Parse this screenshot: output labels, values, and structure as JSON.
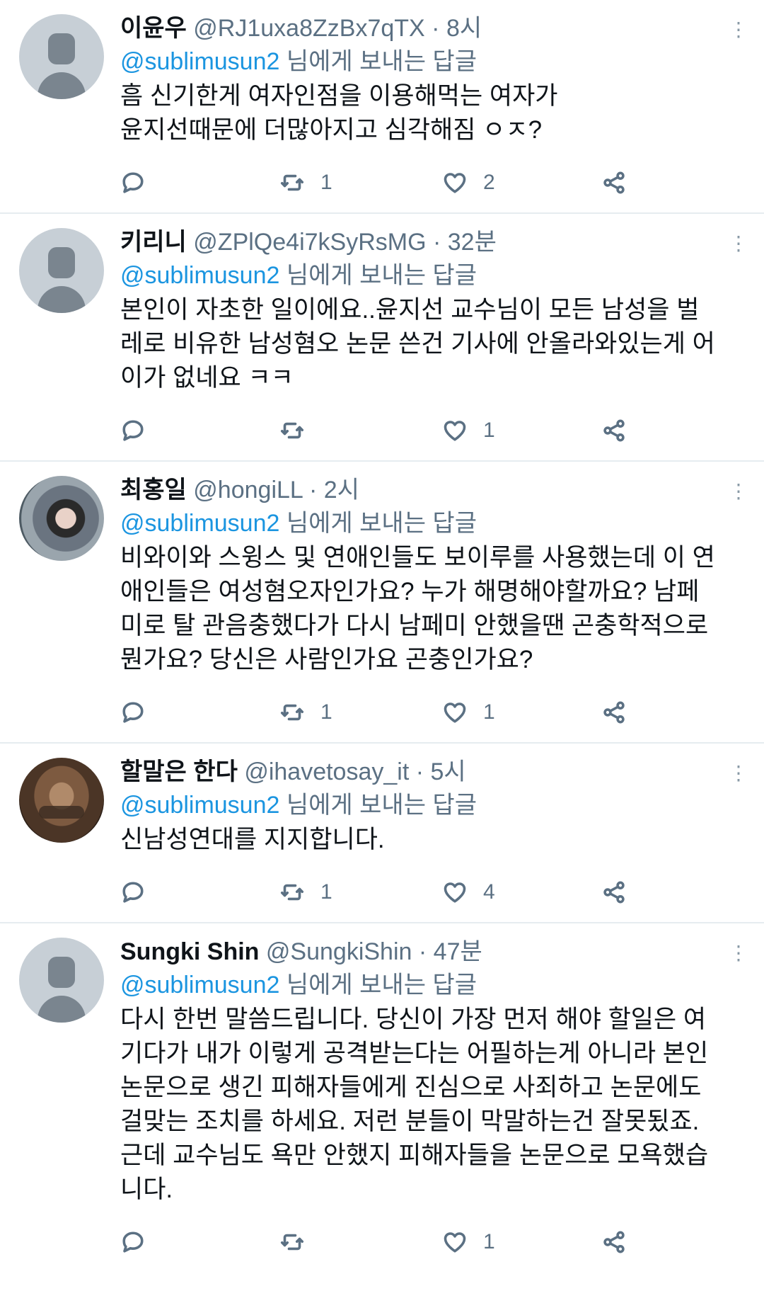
{
  "colors": {
    "text": "#0f1419",
    "muted": "#5b7083",
    "mention": "#1b95e0",
    "divider": "#e6ecf0"
  },
  "tweets": [
    {
      "name": "이윤우",
      "handle": "@RJ1uxa8ZzBx7qTX",
      "time": "8시",
      "reply_mention": "@sublimusun2",
      "reply_suffix": " 님에게 보내는 답글",
      "text": "흠 신기한게 여자인점을 이용해먹는 여자가\n윤지선때문에 더많아지고 심각해짐 ㅇㅈ?",
      "retweets": "1",
      "likes": "2",
      "avatar": "default"
    },
    {
      "name": "키리니",
      "handle": "@ZPlQe4i7kSyRsMG",
      "time": "32분",
      "reply_mention": "@sublimusun2",
      "reply_suffix": " 님에게 보내는 답글",
      "text": "본인이 자초한 일이에요..윤지선 교수님이 모든 남성을 벌\n레로 비유한 남성혐오 논문 쓴건 기사에 안올라와있는게 어\n이가 없네요 ㅋㅋ",
      "retweets": "",
      "likes": "1",
      "avatar": "default"
    },
    {
      "name": "최홍일",
      "handle": "@hongiLL",
      "time": "2시",
      "reply_mention": "@sublimusun2",
      "reply_suffix": " 님에게 보내는 답글",
      "text": "비와이와 스윙스 및 연애인들도 보이루를 사용했는데 이 연\n애인들은 여성혐오자인가요? 누가 해명해야할까요? 남페\n미로 탈 관음충했다가 다시 남페미 안했을땐  곤충학적으로\n뭔가요? 당신은 사람인가요 곤충인가요?",
      "retweets": "1",
      "likes": "1",
      "avatar": "photo1"
    },
    {
      "name": "할말은 한다",
      "handle": "@ihavetosay_it",
      "time": "5시",
      "reply_mention": "@sublimusun2",
      "reply_suffix": " 님에게 보내는 답글",
      "text": "신남성연대를 지지합니다.",
      "retweets": "1",
      "likes": "4",
      "avatar": "photo2"
    },
    {
      "name": "Sungki Shin",
      "handle": "@SungkiShin",
      "time": "47분",
      "reply_mention": "@sublimusun2",
      "reply_suffix": " 님에게 보내는 답글",
      "text": "다시 한번 말씀드립니다. 당신이 가장 먼저 해야 할일은 여\n기다가 내가 이렇게 공격받는다는 어필하는게 아니라 본인\n논문으로 생긴 피해자들에게 진심으로 사죄하고 논문에도\n걸맞는 조치를 하세요. 저런 분들이 막말하는건 잘못됬죠.\n근데 교수님도 욕만 안했지 피해자들을 논문으로 모욕했습\n니다.",
      "retweets": "",
      "likes": "1",
      "avatar": "default"
    }
  ],
  "separator": " · "
}
